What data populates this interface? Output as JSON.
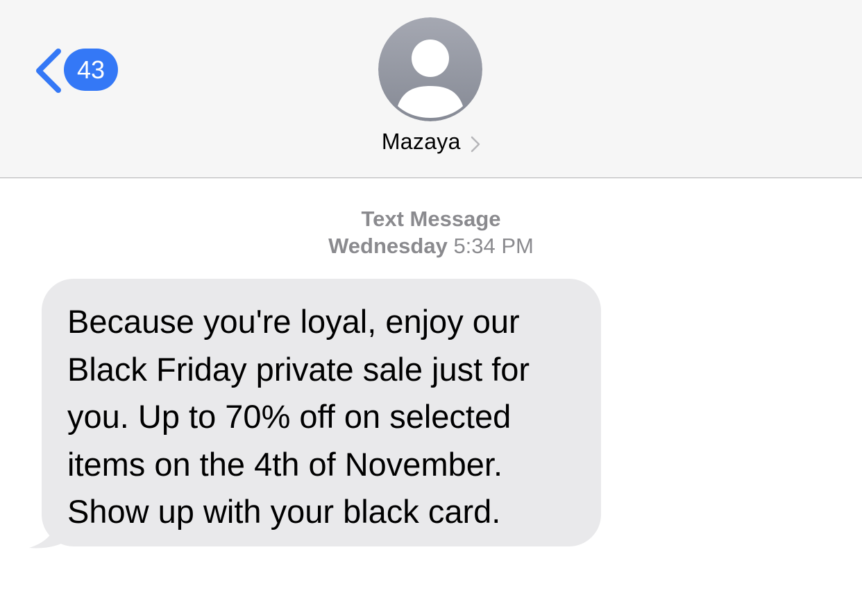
{
  "header": {
    "back_badge_count": "43",
    "contact_name": "Mazaya"
  },
  "thread": {
    "message_kind": "Text Message",
    "timestamp_day": "Wednesday",
    "timestamp_time": "5:34 PM",
    "messages": [
      {
        "direction": "incoming",
        "text": "Because you're loyal, enjoy our Black Friday private sale just for you. Up to 70% off on selected items on the 4th of November. Show up with your black card."
      }
    ]
  },
  "colors": {
    "accent": "#3478f6",
    "header_bg": "#f6f6f6",
    "incoming_bubble": "#e9e9eb",
    "meta_text": "#8a8a8e"
  },
  "icons": {
    "back": "chevron-left-icon",
    "avatar": "person-placeholder-icon",
    "contact_details": "chevron-right-icon"
  }
}
